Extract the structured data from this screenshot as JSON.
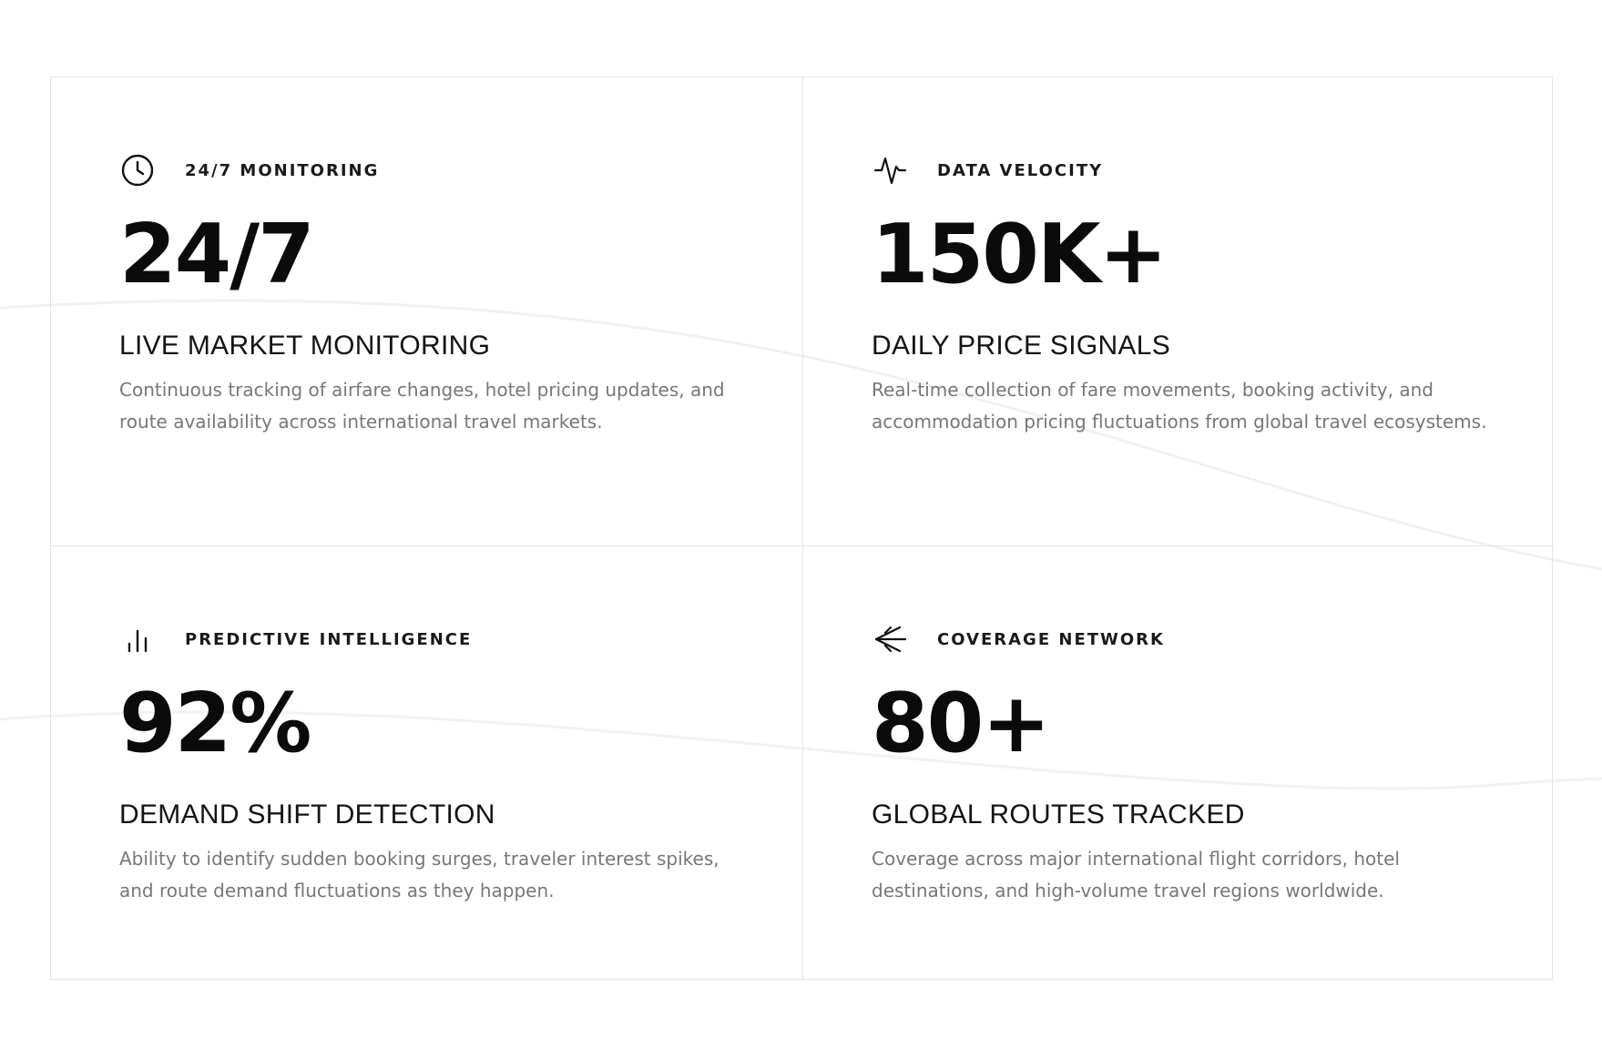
{
  "cards": [
    {
      "icon": "clock-icon",
      "eyebrow": "24/7 MONITORING",
      "stat": "24/7",
      "heading": "LIVE MARKET MONITORING",
      "description": "Continuous tracking of airfare changes, hotel pricing updates, and route availability across international travel markets."
    },
    {
      "icon": "pulse-icon",
      "eyebrow": "DATA VELOCITY",
      "stat": "150K+",
      "heading": "DAILY PRICE SIGNALS",
      "description": "Real-time collection of fare movements, booking activity, and accommodation pricing fluctuations from global travel ecosystems."
    },
    {
      "icon": "bar-chart-icon",
      "eyebrow": "PREDICTIVE INTELLIGENCE",
      "stat": "92%",
      "heading": "DEMAND SHIFT DETECTION",
      "description": "Ability to identify sudden booking surges, traveler interest spikes, and route demand fluctuations as they happen."
    },
    {
      "icon": "network-icon",
      "eyebrow": "COVERAGE NETWORK",
      "stat": "80+",
      "heading": "GLOBAL ROUTES TRACKED",
      "description": "Coverage across major international flight corridors, hotel destinations, and high-volume travel regions worldwide."
    }
  ]
}
